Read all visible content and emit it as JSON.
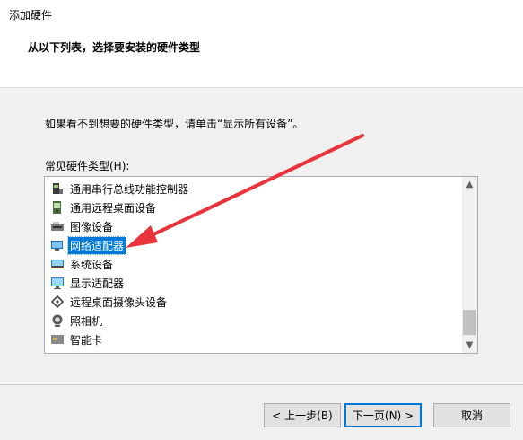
{
  "window": {
    "title": "添加硬件"
  },
  "header": {
    "title": "从以下列表，选择要安装的硬件类型"
  },
  "instruction": "如果看不到想要的硬件类型，请单击“显示所有设备”。",
  "list": {
    "label": "常见硬件类型(H):",
    "items": [
      {
        "label": "通用串行总线功能控制器",
        "icon": "usb-controller-icon"
      },
      {
        "label": "通用远程桌面设备",
        "icon": "remote-desktop-device-icon"
      },
      {
        "label": "图像设备",
        "icon": "imaging-device-icon"
      },
      {
        "label": "网络适配器",
        "icon": "network-adapter-icon",
        "selected": true
      },
      {
        "label": "系统设备",
        "icon": "system-device-icon"
      },
      {
        "label": "显示适配器",
        "icon": "display-adapter-icon"
      },
      {
        "label": "远程桌面摄像头设备",
        "icon": "remote-camera-icon"
      },
      {
        "label": "照相机",
        "icon": "camera-icon"
      },
      {
        "label": "智能卡",
        "icon": "smart-card-icon"
      }
    ]
  },
  "buttons": {
    "back": "< 上一步(B)",
    "next": "下一页(N) >",
    "cancel": "取消"
  },
  "annotation": {
    "arrow_color": "#e8343a"
  },
  "accent": "#0078d7"
}
